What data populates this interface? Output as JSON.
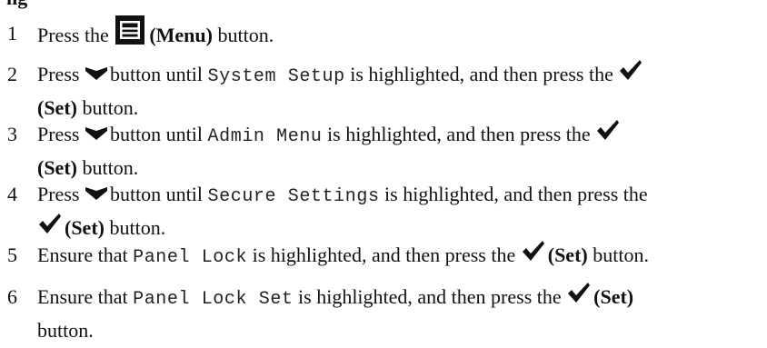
{
  "heading_fragment": "ng",
  "steps": [
    {
      "num": "1",
      "before": "Press the",
      "btn_label": "(Menu)",
      "after": "button."
    },
    {
      "num": "2",
      "before": "Press",
      "after_arrow": "button until",
      "item": "System Setup",
      "middle": "is highlighted, and then press the",
      "btn_label": "(Set)",
      "after": "button."
    },
    {
      "num": "3",
      "before": "Press",
      "after_arrow": "button until",
      "item": "Admin Menu",
      "middle": "is highlighted, and then press the",
      "btn_label": "(Set)",
      "after": "button."
    },
    {
      "num": "4",
      "before": "Press",
      "after_arrow": "button until",
      "item": "Secure Settings",
      "middle": "is highlighted, and then press the",
      "btn_label": "(Set)",
      "after": "button."
    },
    {
      "num": "5",
      "before": "Ensure that",
      "item": "Panel Lock",
      "middle": "is highlighted, and then press the",
      "btn_label": "(Set)",
      "after": "button."
    },
    {
      "num": "6",
      "before": "Ensure that",
      "item": "Panel Lock Set",
      "middle": "is highlighted, and then press the",
      "btn_label": "(Set)",
      "after": "button."
    }
  ],
  "icons": {
    "menu": "menu-icon",
    "down": "down-arrow-icon",
    "check": "check-icon"
  }
}
